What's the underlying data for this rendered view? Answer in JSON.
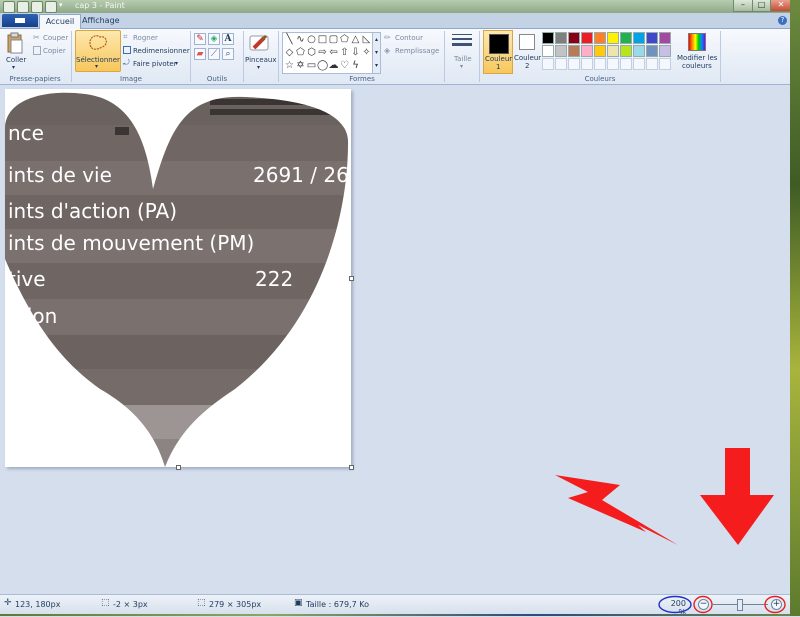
{
  "window": {
    "title": "cap 3 - Paint"
  },
  "tabs": [
    {
      "label": "Accueil"
    },
    {
      "label": "Affichage"
    }
  ],
  "ribbon": {
    "clipboard": {
      "paste": "Coller",
      "cut": "Couper",
      "copy": "Copier",
      "group": "Presse-papiers"
    },
    "image": {
      "select": "Sélectionner",
      "crop": "Rogner",
      "resize": "Redimensionner",
      "rotate": "Faire pivoter",
      "group": "Image"
    },
    "tools": {
      "group": "Outils",
      "text_tool": "A"
    },
    "brushes": {
      "label": "Pinceaux"
    },
    "shapes": {
      "outline": "Contour",
      "fill": "Remplissage",
      "group": "Formes"
    },
    "size": {
      "label": "Taille"
    },
    "colors": {
      "color1": "Couleur 1",
      "color1_line1": "Couleur",
      "color1_line2": "1",
      "color2_line1": "Couleur",
      "color2_line2": "2",
      "edit_line1": "Modifier les",
      "edit_line2": "couleurs",
      "group": "Couleurs",
      "palette_row1": [
        "#000000",
        "#7f7f7f",
        "#880015",
        "#ed1c24",
        "#ff7f27",
        "#fff200",
        "#22b14c",
        "#00a2e8",
        "#3f48cc",
        "#a349a4"
      ],
      "palette_row2": [
        "#ffffff",
        "#c3c3c3",
        "#b97a57",
        "#ffaec9",
        "#ffc90e",
        "#efe4b0",
        "#b5e61d",
        "#99d9ea",
        "#7092be",
        "#c8bfe7"
      ]
    }
  },
  "canvas_image": {
    "lines": [
      {
        "label": "nce",
        "value": ""
      },
      {
        "label": "ints de vie",
        "value": "2691 / 26"
      },
      {
        "label": "ints d'action (PA)",
        "value": ""
      },
      {
        "label": "ints de mouvement (PM)",
        "value": ""
      },
      {
        "label": "tive",
        "value": "222"
      },
      {
        "label": "ction",
        "value": ""
      }
    ]
  },
  "status": {
    "cursor_pos": "123, 180px",
    "selection_size": "-2 × 3px",
    "image_size": "279 × 305px",
    "file_size": "Taille : 679,7 Ko",
    "zoom": "200 %"
  }
}
